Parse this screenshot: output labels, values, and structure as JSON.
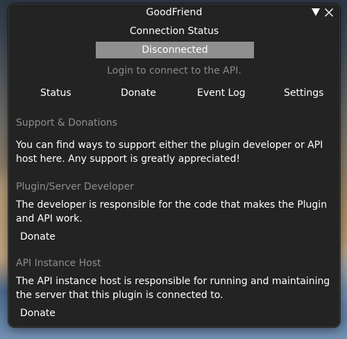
{
  "window": {
    "title": "GoodFriend"
  },
  "connection": {
    "heading": "Connection Status",
    "status": "Disconnected",
    "hint": "Login to connect to the API."
  },
  "tabs": [
    {
      "label": "Status"
    },
    {
      "label": "Donate"
    },
    {
      "label": "Event Log"
    },
    {
      "label": "Settings"
    }
  ],
  "support": {
    "heading": "Support & Donations",
    "text": "You can find ways to support either the plugin developer or API host here. Any support is greatly appreciated!"
  },
  "developer": {
    "heading": "Plugin/Server Developer",
    "text": "The developer is responsible for the code that makes the Plugin and API work.",
    "button": "Donate"
  },
  "host": {
    "heading": "API Instance Host",
    "text": "The API instance host is responsible for running and maintaining the server that this plugin is connected to.",
    "button": "Donate"
  },
  "colors": {
    "window_bg": "#232323",
    "status_bar_bg": "#8f8f8f",
    "muted_text": "#8a8a8a",
    "text": "#ffffff"
  },
  "icons": {
    "minimize": "triangle-down-icon",
    "close": "close-icon"
  }
}
